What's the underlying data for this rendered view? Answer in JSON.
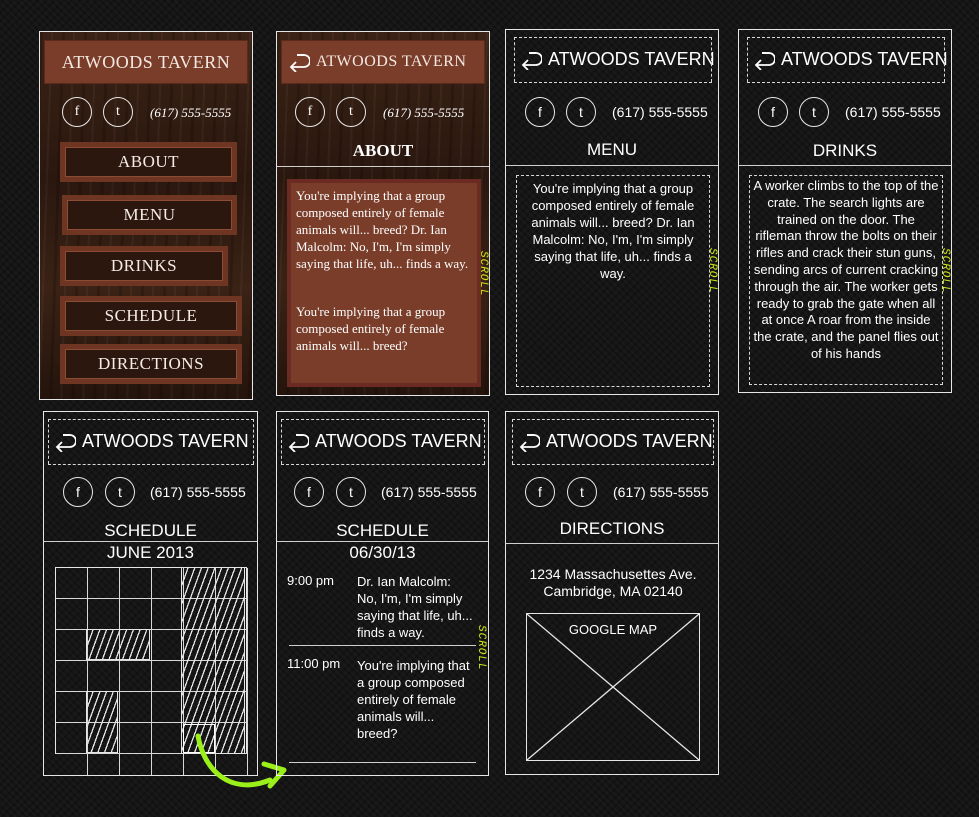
{
  "brand": "ATWOODS TAVERN",
  "phone": "(617) 555-5555",
  "social": {
    "facebook": "f",
    "twitter": "t"
  },
  "nav": [
    "ABOUT",
    "MENU",
    "DRINKS",
    "SCHEDULE",
    "DIRECTIONS"
  ],
  "scroll_label": "SCROLL",
  "colors": {
    "accent": "#cfe818",
    "wood_header": "#7a3d2a",
    "wood_button_border": "#6e3523"
  },
  "icons": {
    "back": "back-arrow-icon",
    "facebook": "facebook-icon",
    "twitter": "twitter-icon",
    "arrow": "curved-arrow-icon"
  },
  "about": {
    "title": "ABOUT",
    "para1": "You're implying that a group composed entirely of female animals will... breed? Dr. Ian Malcolm: No, I'm, I'm simply saying that life, uh... finds a way.",
    "para2": "You're implying that a group composed entirely of female animals will... breed?"
  },
  "menu": {
    "title": "MENU",
    "text": "You're implying that a group composed entirely of female animals will... breed? Dr. Ian Malcolm: No, I'm, I'm simply saying that life, uh... finds a way."
  },
  "drinks": {
    "title": "DRINKS",
    "text": "A worker climbs to the top of the crate. The search lights are trained on the door. The rifleman throw the bolts on their rifles and crack their stun guns, sending arcs of current cracking through the air. The worker gets ready to grab the gate when all at once A roar from the inside the crate, and the panel flies out of his hands"
  },
  "schedule_month": {
    "title": "SCHEDULE",
    "month": "JUNE 2013"
  },
  "schedule_day": {
    "title": "SCHEDULE",
    "date": "06/30/13",
    "events": [
      {
        "time": "9:00 pm",
        "text": "Dr. Ian Malcolm: No, I'm, I'm simply saying that life, uh... finds a way."
      },
      {
        "time": "11:00 pm",
        "text": "You're implying that a group composed entirely of female animals will... breed?"
      }
    ]
  },
  "directions": {
    "title": "DIRECTIONS",
    "address1": "1234 Massachusettes Ave.",
    "address2": "Cambridge, MA 02140",
    "map_label": "GOOGLE MAP"
  }
}
